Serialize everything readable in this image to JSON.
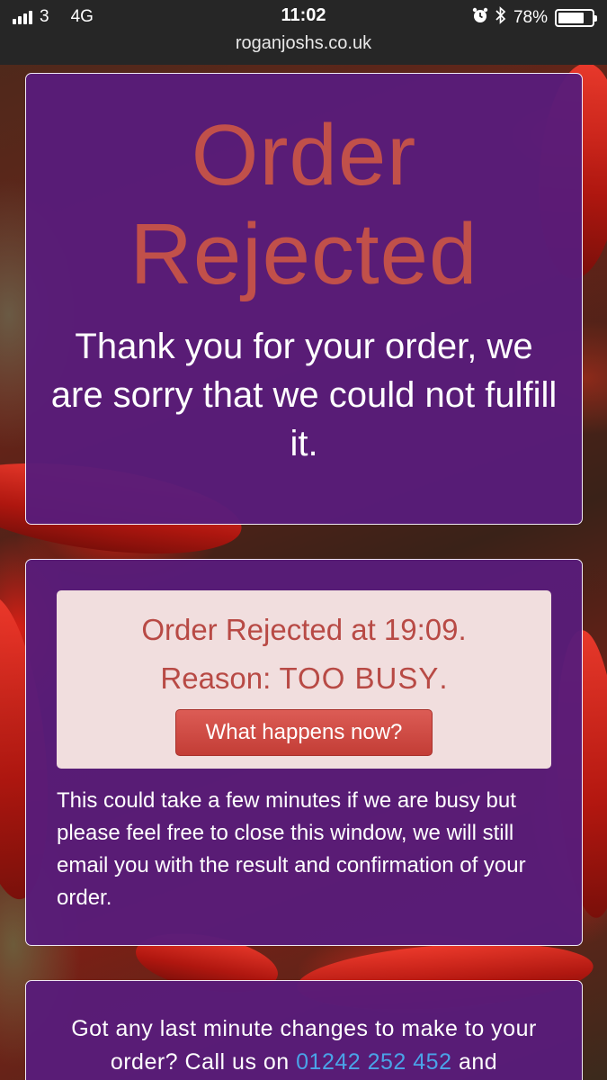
{
  "status_bar": {
    "carrier": "3",
    "network": "4G",
    "time": "11:02",
    "url": "roganjoshs.co.uk",
    "battery_percent": "78%",
    "battery_level": 0.78
  },
  "order_panel": {
    "headline": "Order Rejected",
    "message": "Thank you for your order, we are sorry that we could not fulfill it."
  },
  "rejection": {
    "line1": "Order Rejected at 19:09.",
    "reason_label": "Reason:",
    "reason_value": "TOO BUSY",
    "reason_end": ".",
    "button_label": "What happens now?",
    "info_text": "This could take a few minutes if we are busy but please feel free to close this window, we will still email you with the result and confirmation of your order."
  },
  "changes_panel": {
    "text_before": "Got any last minute changes to make to your order? Call us on",
    "phone": "01242 252 452",
    "text_after": "and"
  },
  "colors": {
    "panel": "#581c7a",
    "headline": "#c1504a",
    "alert_bg": "#f1dede",
    "button": "#c9433c",
    "link": "#4aa3e8"
  }
}
